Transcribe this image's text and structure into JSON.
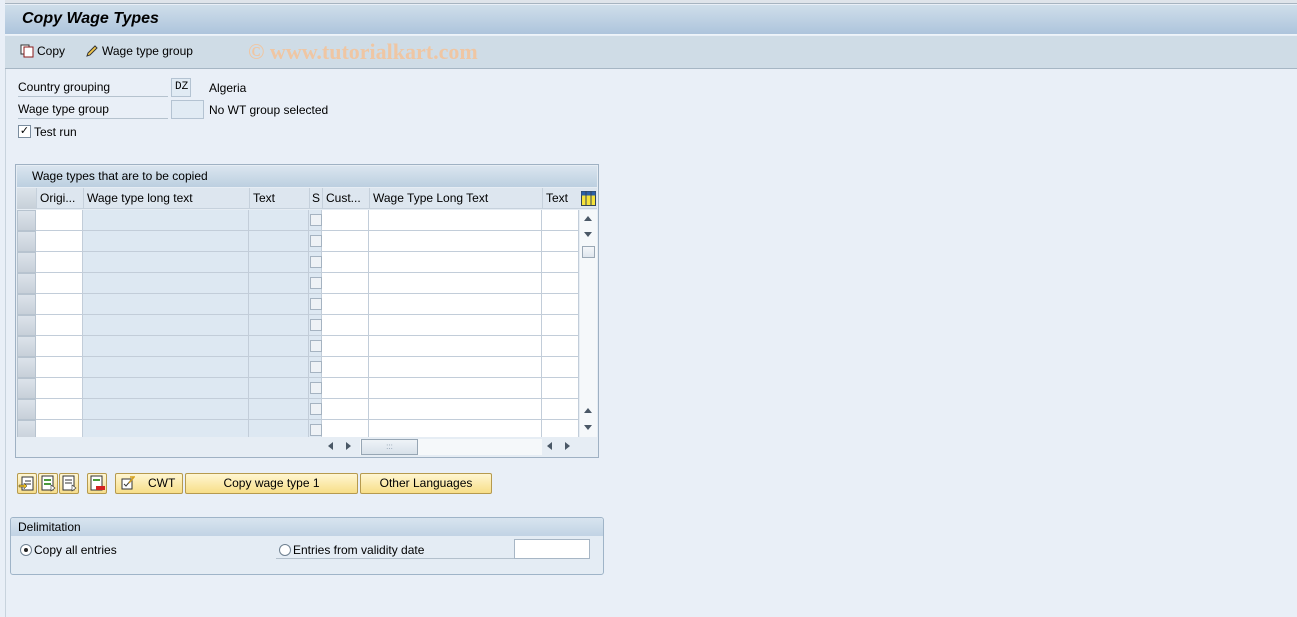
{
  "window": {
    "title": "Copy Wage Types"
  },
  "toolbar": {
    "copy_label": "Copy",
    "copy_icon": "copy-icon",
    "wage_type_group_label": "Wage type group",
    "wage_type_group_icon": "pencil-icon",
    "watermark": "© www.tutorialkart.com"
  },
  "form": {
    "country_grouping_label": "Country grouping",
    "country_grouping_value": "DZ",
    "country_grouping_text": "Algeria",
    "wage_type_group_label": "Wage type group",
    "wage_type_group_value": "",
    "wage_type_group_text": "No WT group selected",
    "test_run_label": "Test run",
    "test_run_checked": true,
    "test_run_mark": "✓"
  },
  "table": {
    "title": "Wage types that are to be copied",
    "columns": [
      "Origi...",
      "Wage type long text",
      "Text",
      "S",
      "Cust...",
      "Wage Type Long Text",
      "Text"
    ],
    "settings_icon": "table-settings-icon",
    "row_count": 11,
    "rows": [],
    "hthumb_grip": ":::"
  },
  "buttons": {
    "icon_buttons": [
      "insert-row-icon",
      "select-all-icon",
      "select-block-icon",
      "delete-row-icon"
    ],
    "cwt_label": "CWT",
    "copy_wage_type_label": "Copy wage type 1",
    "other_languages_label": "Other Languages"
  },
  "delimitation": {
    "title": "Delimitation",
    "copy_all_label": "Copy all entries",
    "copy_all_selected": true,
    "from_date_label": "Entries from validity date",
    "from_date_value": ""
  },
  "colors": {
    "background": "#e9eff7",
    "title_bar": "#adc4dc",
    "button_yellow": "#f7de88",
    "watermark": "#efc6a3"
  }
}
